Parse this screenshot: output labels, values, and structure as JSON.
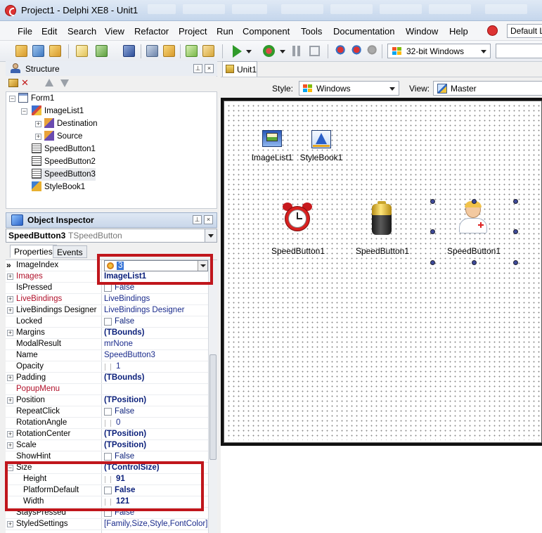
{
  "window": {
    "title": "Project1 - Delphi XE8 - Unit1"
  },
  "menu": {
    "items": [
      "File",
      "Edit",
      "Search",
      "View",
      "Refactor",
      "Project",
      "Run",
      "Component",
      "Tools",
      "Documentation",
      "Window",
      "Help"
    ],
    "layout": "Default Layout"
  },
  "toolbar": {
    "platform": "32-bit Windows"
  },
  "structure": {
    "title": "Structure",
    "tree": [
      {
        "label": "Form1",
        "level": 0,
        "expander": "−"
      },
      {
        "label": "ImageList1",
        "level": 1,
        "expander": "−"
      },
      {
        "label": "Destination",
        "level": 2,
        "expander": "+"
      },
      {
        "label": "Source",
        "level": 2,
        "expander": "+"
      },
      {
        "label": "SpeedButton1",
        "level": 1,
        "expander": ""
      },
      {
        "label": "SpeedButton2",
        "level": 1,
        "expander": ""
      },
      {
        "label": "SpeedButton3",
        "level": 1,
        "expander": ""
      },
      {
        "label": "StyleBook1",
        "level": 1,
        "expander": ""
      }
    ]
  },
  "inspector": {
    "title": "Object Inspector",
    "selected_name": "SpeedButton3",
    "selected_type": "TSpeedButton",
    "tabs": [
      "Properties",
      "Events"
    ],
    "image_index_value": "3",
    "properties": [
      {
        "name": "ImageIndex",
        "value": "3",
        "editor": "combo",
        "exp": "",
        "style": ""
      },
      {
        "name": "Images",
        "value": "ImageList1",
        "editor": "",
        "exp": "+",
        "style": "bold",
        "red": true
      },
      {
        "name": "IsPressed",
        "value": "False",
        "editor": "check",
        "exp": "",
        "style": ""
      },
      {
        "name": "LiveBindings",
        "value": "LiveBindings",
        "editor": "",
        "exp": "+",
        "style": "plain",
        "red": true
      },
      {
        "name": "LiveBindings Designer",
        "value": "LiveBindings Designer",
        "editor": "",
        "exp": "+",
        "style": "plain"
      },
      {
        "name": "Locked",
        "value": "False",
        "editor": "check",
        "exp": "",
        "style": ""
      },
      {
        "name": "Margins",
        "value": "(TBounds)",
        "editor": "",
        "exp": "+",
        "style": "bold"
      },
      {
        "name": "ModalResult",
        "value": "mrNone",
        "editor": "",
        "exp": "",
        "style": "plain"
      },
      {
        "name": "Name",
        "value": "SpeedButton3",
        "editor": "",
        "exp": "",
        "style": "plain"
      },
      {
        "name": "Opacity",
        "value": "1",
        "editor": "spin",
        "exp": "",
        "style": "plain"
      },
      {
        "name": "Padding",
        "value": "(TBounds)",
        "editor": "",
        "exp": "+",
        "style": "bold"
      },
      {
        "name": "PopupMenu",
        "value": "",
        "editor": "",
        "exp": "",
        "style": "",
        "red": true
      },
      {
        "name": "Position",
        "value": "(TPosition)",
        "editor": "",
        "exp": "+",
        "style": "bold"
      },
      {
        "name": "RepeatClick",
        "value": "False",
        "editor": "check",
        "exp": "",
        "style": ""
      },
      {
        "name": "RotationAngle",
        "value": "0",
        "editor": "spin",
        "exp": "",
        "style": "plain"
      },
      {
        "name": "RotationCenter",
        "value": "(TPosition)",
        "editor": "",
        "exp": "+",
        "style": "bold"
      },
      {
        "name": "Scale",
        "value": "(TPosition)",
        "editor": "",
        "exp": "+",
        "style": "bold"
      },
      {
        "name": "ShowHint",
        "value": "False",
        "editor": "check",
        "exp": "",
        "style": ""
      },
      {
        "name": "Size",
        "value": "(TControlSize)",
        "editor": "",
        "exp": "−",
        "style": "bold"
      },
      {
        "name": "Height",
        "value": "91",
        "editor": "spin",
        "exp": "",
        "style": "bold",
        "sub": true
      },
      {
        "name": "PlatformDefault",
        "value": "False",
        "editor": "check",
        "exp": "",
        "style": "bold",
        "sub": true
      },
      {
        "name": "Width",
        "value": "121",
        "editor": "spin",
        "exp": "",
        "style": "bold",
        "sub": true
      },
      {
        "name": "StaysPressed",
        "value": "False",
        "editor": "check",
        "exp": "",
        "style": ""
      },
      {
        "name": "StyledSettings",
        "value": "[Family,Size,Style,FontColor]",
        "editor": "",
        "exp": "+",
        "style": "plain"
      }
    ]
  },
  "designer": {
    "tab": "Unit1",
    "style_label": "Style:",
    "style_value": "Windows",
    "view_label": "View:",
    "view_value": "Master",
    "nonvisual": [
      {
        "label": "ImageList1",
        "icon": "imagelist-icon"
      },
      {
        "label": "StyleBook1",
        "icon": "stylebook-icon"
      }
    ],
    "buttons": [
      {
        "label": "SpeedButton1",
        "icon": "alarm-clock-icon"
      },
      {
        "label": "SpeedButton1",
        "icon": "battery-icon"
      },
      {
        "label": "SpeedButton1",
        "icon": "doctor-icon"
      }
    ]
  },
  "colors": {
    "highlight_frame": "#c0161c",
    "property_value": "#0a1f7a",
    "event_property": "#b0102a"
  }
}
